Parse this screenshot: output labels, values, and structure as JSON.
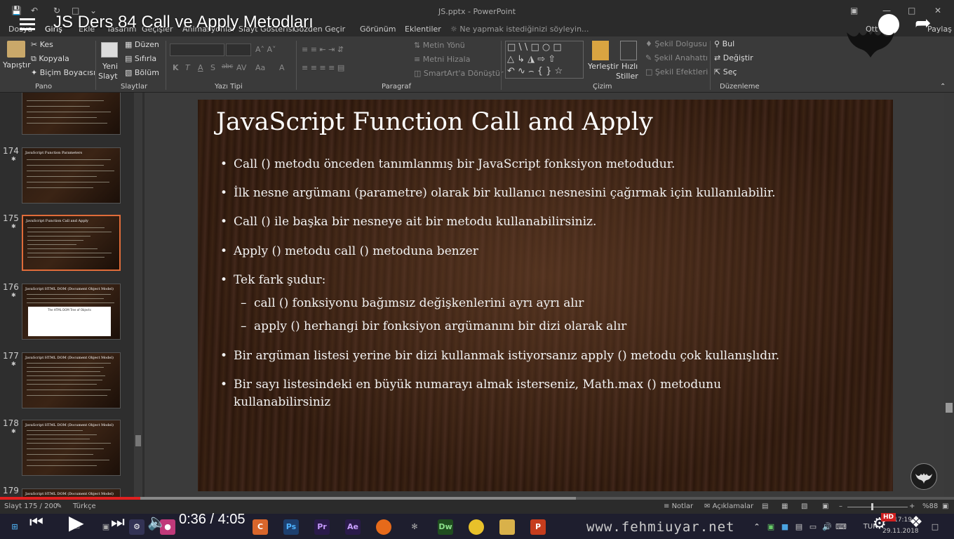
{
  "window": {
    "title": "JS.pptx - PowerPoint",
    "account_label": "Ott",
    "share_label": "Paylaş"
  },
  "youtube": {
    "video_title": "JS Ders 84 Call ve Apply Metodları",
    "time": "0:36 / 4:05",
    "progress": 0.147,
    "buffered": 0.604,
    "hd_badge": "HD"
  },
  "menu": {
    "file": "Dosya",
    "tabs": [
      "Giriş",
      "Ekle",
      "Tasarım",
      "Geçişler",
      "Animasyonlar",
      "Slayt Gösterisi",
      "Gözden Geçir",
      "Görünüm",
      "Eklentiler"
    ],
    "tell_me": "Ne yapmak istediğinizi söyleyin..."
  },
  "ribbon": {
    "pano": {
      "paste": "Yapıştır",
      "cut": "Kes",
      "copy": "Kopyala",
      "format_painter": "Biçim Boyacısı",
      "label": "Pano"
    },
    "slaytlar": {
      "new_slide_1": "Yeni",
      "new_slide_2": "Slayt",
      "layout": "Düzen",
      "reset": "Sıfırla",
      "section": "Bölüm",
      "label": "Slaytlar"
    },
    "yazi_tipi": {
      "label": "Yazı Tipi",
      "bold": "K",
      "italic": "T",
      "underline": "A",
      "shadow": "S",
      "strike": "abc",
      "spacing": "AV",
      "case": "Aa"
    },
    "paragraf": {
      "text_direction": "Metin Yönü",
      "align_text": "Metni Hizala",
      "smartart": "SmartArt'a Dönüştür",
      "label": "Paragraf"
    },
    "cizim": {
      "arrange": "Yerleştir",
      "quick_styles_1": "Hızlı",
      "quick_styles_2": "Stiller",
      "shape_fill": "Şekil Dolgusu",
      "shape_outline": "Şekil Anahattı",
      "shape_effects": "Şekil Efektleri",
      "label": "Çizim"
    },
    "duzenleme": {
      "find": "Bul",
      "replace": "Değiştir",
      "select": "Seç",
      "label": "Düzenleme"
    }
  },
  "thumbnails": [
    {
      "num": "",
      "title": "",
      "image": false
    },
    {
      "num": "174",
      "title": "JavaScript Function Parameters",
      "image": false
    },
    {
      "num": "175",
      "title": "JavaScript Function Call and Apply",
      "image": false
    },
    {
      "num": "176",
      "title": "JavaScript HTML DOM (Document Object Model)",
      "image": true
    },
    {
      "num": "177",
      "title": "JavaScript HTML DOM (Document Object Model)",
      "image": false
    },
    {
      "num": "178",
      "title": "JavaScript HTML DOM (Document Object Model)",
      "image": false
    },
    {
      "num": "179",
      "title": "JavaScript HTML DOM (Document Object Model)",
      "image": false
    }
  ],
  "thumbnail_image_caption": "The HTML DOM Tree of Objects",
  "slide": {
    "title": "JavaScript Function Call and Apply",
    "bullets": [
      "Call () metodu önceden tanımlanmış bir JavaScript fonksiyon metodudur.",
      "İlk nesne argümanı (parametre) olarak bir kullanıcı nesnesini çağırmak için kullanılabilir.",
      "Call () ile başka bir nesneye ait bir metodu kullanabilirsiniz.",
      "Apply () metodu call () metoduna benzer",
      "Tek fark şudur:"
    ],
    "sub_bullets": [
      "call () fonksiyonu bağımsız değişkenlerini ayrı ayrı alır",
      "apply () herhangi bir fonksiyon argümanını bir dizi olarak alır"
    ],
    "bullets_after": [
      "Bir argüman listesi yerine bir dizi kullanmak istiyorsanız apply () metodu çok kullanışlıdır."
    ],
    "last_bullet_line1": "Bir sayı listesindeki en büyük numarayı almak isterseniz, Math.max () metodunu",
    "last_bullet_line2": "kullanabilirsiniz"
  },
  "status": {
    "slide_count": "Slayt 175 / 200",
    "language": "Türkçe",
    "notes": "Notlar",
    "comments": "Açıklamalar",
    "zoom": "%88"
  },
  "taskbar": {
    "watermark": "www.fehmiuyar.net",
    "language": "TUR",
    "clock_time": "17:19",
    "clock_date": "29.11.2018"
  },
  "colors": {
    "accent": "#e06c3a",
    "progress_played": "#e02020",
    "slide_text": "#f2f2f2"
  }
}
